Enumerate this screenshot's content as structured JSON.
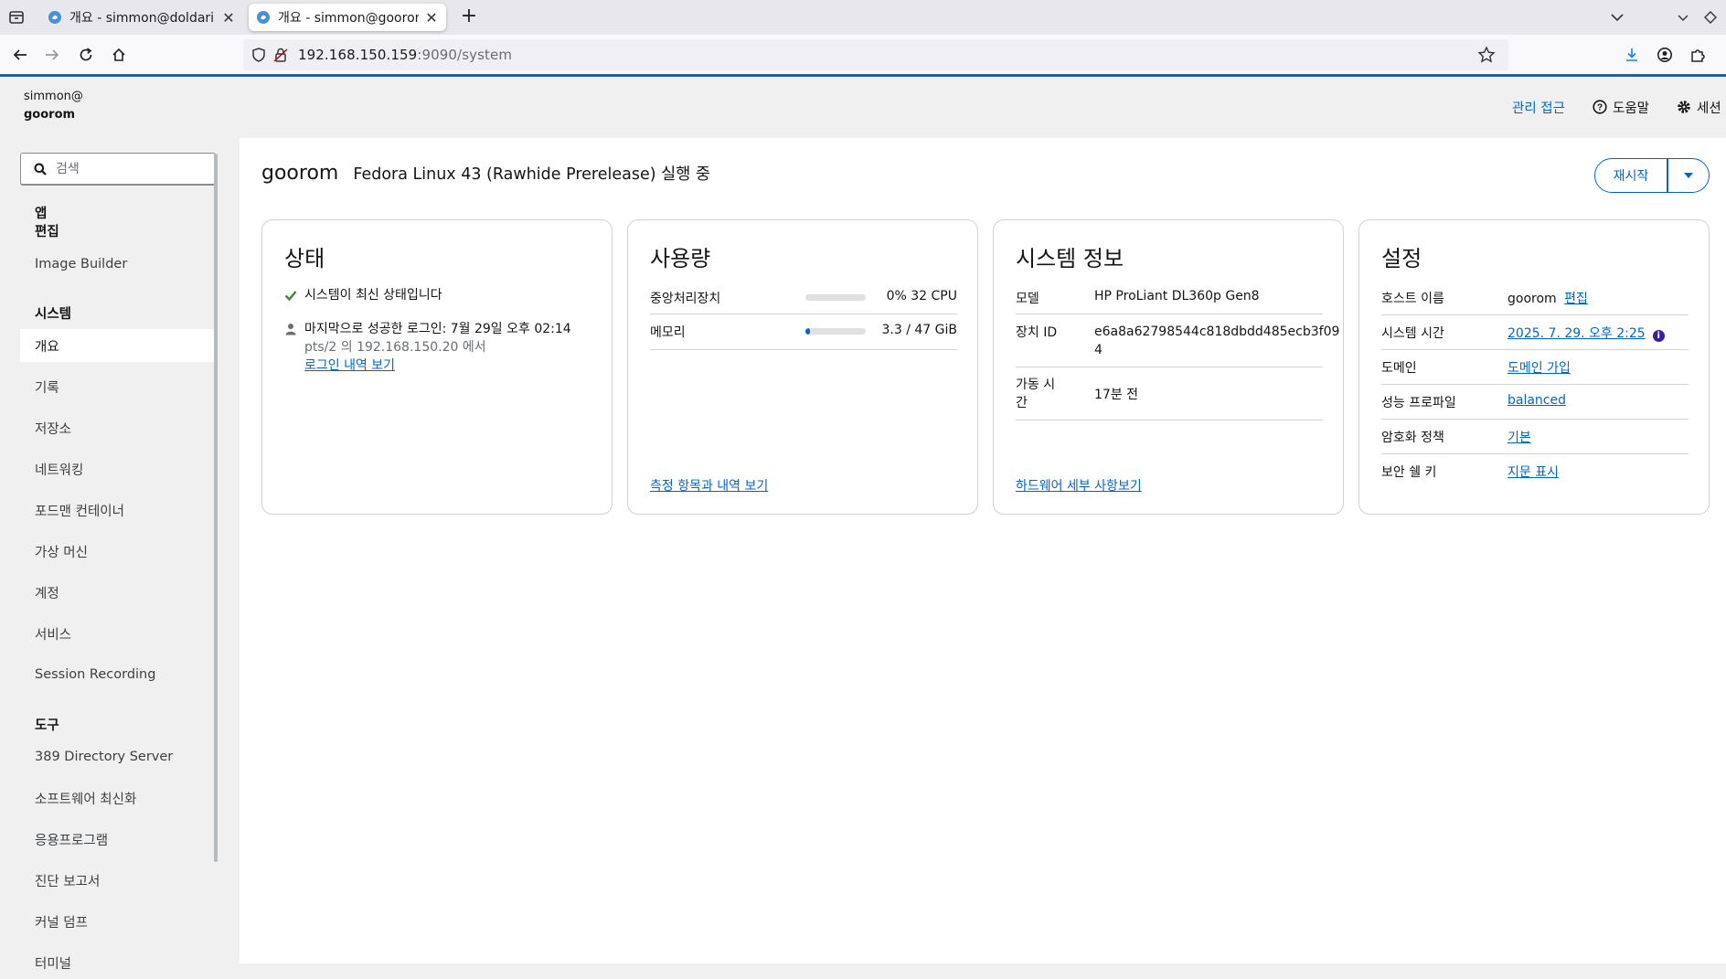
{
  "browser": {
    "tabs": [
      {
        "title": "개요 - simmon@doldari",
        "active": false
      },
      {
        "title": "개요 - simmon@goorom",
        "active": true
      }
    ],
    "url_host": "192.168.150.159",
    "url_rest": ":9090/system"
  },
  "shell": {
    "user": "simmon@",
    "host": "goorom",
    "admin_access": "관리 접근",
    "help": "도움말",
    "session": "세션"
  },
  "sidebar": {
    "search_placeholder": "검색",
    "apps_section": "앱",
    "edit_label": "편집",
    "image_builder": "Image Builder",
    "system_section": "시스템",
    "system_items": [
      "개요",
      "기록",
      "저장소",
      "네트워킹",
      "포드맨 컨테이너",
      "가상 머신",
      "계정",
      "서비스",
      "Session Recording"
    ],
    "tools_section": "도구",
    "tools_items": [
      "389 Directory Server",
      "소프트웨어 최신화",
      "응용프로그램",
      "진단 보고서",
      "커널 덤프",
      "터미널"
    ]
  },
  "page": {
    "hostname": "goorom",
    "os_status": "Fedora Linux 43 (Rawhide Prerelease) 실행 중",
    "restart": "재시작"
  },
  "status_card": {
    "title": "상태",
    "up_to_date": "시스템이 최신 상태입니다",
    "last_login": "마지막으로 성공한 로그인: 7월 29일 오후 02:14",
    "login_from": "pts/2 의 192.168.150.20 에서",
    "login_history_link": "로그인 내역 보기"
  },
  "usage_card": {
    "title": "사용량",
    "cpu_label": "중앙처리장치",
    "cpu_value": "0% 32 CPU",
    "cpu_fraction": 0.0,
    "memory_label": "메모리",
    "memory_value": "3.3 / 47 GiB",
    "memory_fraction": 0.07,
    "metrics_link": "측정 항목과 내역 보기"
  },
  "sysinfo_card": {
    "title": "시스템 정보",
    "model_label": "모델",
    "model_value": "HP ProLiant DL360p Gen8",
    "machine_id_label": "장치 ID",
    "machine_id_line1": "e6a8a62798544c818dbdd485ecb3f09",
    "machine_id_line2": "4",
    "uptime_label_line1": "가동 시",
    "uptime_label_line2": "간",
    "uptime_value": "17분 전",
    "hardware_link": "하드웨어 세부 사항보기"
  },
  "config_card": {
    "title": "설정",
    "hostname_label": "호스트 이름",
    "hostname_value": "goorom",
    "hostname_edit": "편집",
    "time_label": "시스템 시간",
    "time_value": "2025. 7. 29. 오후 2:25",
    "domain_label": "도메인",
    "domain_value": "도메인 가입",
    "profile_label": "성능 프로파일",
    "profile_value": "balanced",
    "crypto_label": "암호화 정책",
    "crypto_value": "기본",
    "ssh_label": "보안 쉘 키",
    "ssh_value": "지문 표시"
  },
  "colors": {
    "accent": "#0066cc",
    "success": "#3e8635",
    "info": "#3d1ea3"
  }
}
